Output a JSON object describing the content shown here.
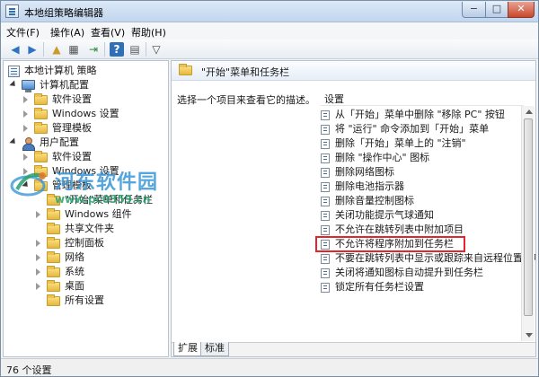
{
  "window": {
    "title": "本地组策略编辑器",
    "minimize": "−",
    "maximize": "□",
    "close": "✕"
  },
  "menu": [
    "文件(F)",
    "操作(A)",
    "查看(V)",
    "帮助(H)"
  ],
  "toolbar": {
    "back": "◀",
    "forward": "▶",
    "up": "▲",
    "show_hide": "▦",
    "export": "⇥",
    "help": "?",
    "properties": "▤",
    "filter": "▽"
  },
  "tree": {
    "root": "本地计算机 策略",
    "computer_config": "计算机配置",
    "c_software": "软件设置",
    "c_windows": "Windows 设置",
    "c_admin": "管理模板",
    "user_config": "用户配置",
    "u_software": "软件设置",
    "u_windows": "Windows 设置",
    "u_admin": "管理模板",
    "start_menu": "\"开始\"菜单和任务栏",
    "windows_components": "Windows 组件",
    "shared_folders": "共享文件夹",
    "control_panel": "控制面板",
    "network": "网络",
    "system": "系统",
    "desktop": "桌面",
    "all_settings": "所有设置"
  },
  "right": {
    "header": "\"开始\"菜单和任务栏",
    "description": "选择一个项目来查看它的描述。",
    "settings_column": "设置",
    "items": [
      "从「开始」菜单中删除 \"移除 PC\" 按钮",
      "将 \"运行\" 命令添加到「开始」菜单",
      "删除「开始」菜单上的 \"注销\"",
      "删除 \"操作中心\" 图标",
      "删除网络图标",
      "删除电池指示器",
      "删除音量控制图标",
      "关闭功能提示气球通知",
      "不允许在跳转列表中附加项目",
      "不允许将程序附加到任务栏",
      "不要在跳转列表中显示或跟踪来自远程位置的项目",
      "关闭将通知图标自动提升到任务栏",
      "锁定所有任务栏设置"
    ],
    "highlighted_index": 9,
    "highlight_color": "#e3262d"
  },
  "tabs": [
    "扩展",
    "标准"
  ],
  "status": "76 个设置",
  "watermark": {
    "name": "河东软件园",
    "url": "www.pc0359.cn"
  }
}
